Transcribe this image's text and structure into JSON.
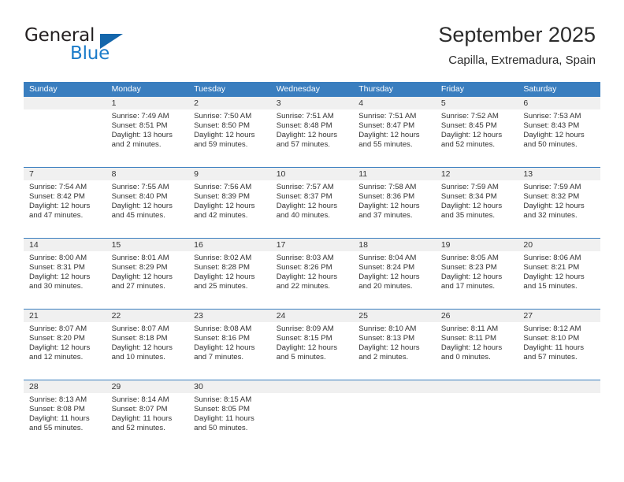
{
  "brand": {
    "name_top": "General",
    "name_bottom": "Blue",
    "triangle_color": "#1466ab",
    "blue_text_color": "#1a7bc9"
  },
  "header": {
    "title": "September 2025",
    "subtitle": "Capilla, Extremadura, Spain"
  },
  "theme": {
    "header_band": "#3a7ebf",
    "daynum_band": "#f0f0f0",
    "text": "#333333"
  },
  "weekdays": [
    "Sunday",
    "Monday",
    "Tuesday",
    "Wednesday",
    "Thursday",
    "Friday",
    "Saturday"
  ],
  "weeks": [
    [
      {
        "day": "",
        "sunrise": "",
        "sunset": "",
        "daylight_1": "",
        "daylight_2": ""
      },
      {
        "day": "1",
        "sunrise": "Sunrise: 7:49 AM",
        "sunset": "Sunset: 8:51 PM",
        "daylight_1": "Daylight: 13 hours",
        "daylight_2": "and 2 minutes."
      },
      {
        "day": "2",
        "sunrise": "Sunrise: 7:50 AM",
        "sunset": "Sunset: 8:50 PM",
        "daylight_1": "Daylight: 12 hours",
        "daylight_2": "and 59 minutes."
      },
      {
        "day": "3",
        "sunrise": "Sunrise: 7:51 AM",
        "sunset": "Sunset: 8:48 PM",
        "daylight_1": "Daylight: 12 hours",
        "daylight_2": "and 57 minutes."
      },
      {
        "day": "4",
        "sunrise": "Sunrise: 7:51 AM",
        "sunset": "Sunset: 8:47 PM",
        "daylight_1": "Daylight: 12 hours",
        "daylight_2": "and 55 minutes."
      },
      {
        "day": "5",
        "sunrise": "Sunrise: 7:52 AM",
        "sunset": "Sunset: 8:45 PM",
        "daylight_1": "Daylight: 12 hours",
        "daylight_2": "and 52 minutes."
      },
      {
        "day": "6",
        "sunrise": "Sunrise: 7:53 AM",
        "sunset": "Sunset: 8:43 PM",
        "daylight_1": "Daylight: 12 hours",
        "daylight_2": "and 50 minutes."
      }
    ],
    [
      {
        "day": "7",
        "sunrise": "Sunrise: 7:54 AM",
        "sunset": "Sunset: 8:42 PM",
        "daylight_1": "Daylight: 12 hours",
        "daylight_2": "and 47 minutes."
      },
      {
        "day": "8",
        "sunrise": "Sunrise: 7:55 AM",
        "sunset": "Sunset: 8:40 PM",
        "daylight_1": "Daylight: 12 hours",
        "daylight_2": "and 45 minutes."
      },
      {
        "day": "9",
        "sunrise": "Sunrise: 7:56 AM",
        "sunset": "Sunset: 8:39 PM",
        "daylight_1": "Daylight: 12 hours",
        "daylight_2": "and 42 minutes."
      },
      {
        "day": "10",
        "sunrise": "Sunrise: 7:57 AM",
        "sunset": "Sunset: 8:37 PM",
        "daylight_1": "Daylight: 12 hours",
        "daylight_2": "and 40 minutes."
      },
      {
        "day": "11",
        "sunrise": "Sunrise: 7:58 AM",
        "sunset": "Sunset: 8:36 PM",
        "daylight_1": "Daylight: 12 hours",
        "daylight_2": "and 37 minutes."
      },
      {
        "day": "12",
        "sunrise": "Sunrise: 7:59 AM",
        "sunset": "Sunset: 8:34 PM",
        "daylight_1": "Daylight: 12 hours",
        "daylight_2": "and 35 minutes."
      },
      {
        "day": "13",
        "sunrise": "Sunrise: 7:59 AM",
        "sunset": "Sunset: 8:32 PM",
        "daylight_1": "Daylight: 12 hours",
        "daylight_2": "and 32 minutes."
      }
    ],
    [
      {
        "day": "14",
        "sunrise": "Sunrise: 8:00 AM",
        "sunset": "Sunset: 8:31 PM",
        "daylight_1": "Daylight: 12 hours",
        "daylight_2": "and 30 minutes."
      },
      {
        "day": "15",
        "sunrise": "Sunrise: 8:01 AM",
        "sunset": "Sunset: 8:29 PM",
        "daylight_1": "Daylight: 12 hours",
        "daylight_2": "and 27 minutes."
      },
      {
        "day": "16",
        "sunrise": "Sunrise: 8:02 AM",
        "sunset": "Sunset: 8:28 PM",
        "daylight_1": "Daylight: 12 hours",
        "daylight_2": "and 25 minutes."
      },
      {
        "day": "17",
        "sunrise": "Sunrise: 8:03 AM",
        "sunset": "Sunset: 8:26 PM",
        "daylight_1": "Daylight: 12 hours",
        "daylight_2": "and 22 minutes."
      },
      {
        "day": "18",
        "sunrise": "Sunrise: 8:04 AM",
        "sunset": "Sunset: 8:24 PM",
        "daylight_1": "Daylight: 12 hours",
        "daylight_2": "and 20 minutes."
      },
      {
        "day": "19",
        "sunrise": "Sunrise: 8:05 AM",
        "sunset": "Sunset: 8:23 PM",
        "daylight_1": "Daylight: 12 hours",
        "daylight_2": "and 17 minutes."
      },
      {
        "day": "20",
        "sunrise": "Sunrise: 8:06 AM",
        "sunset": "Sunset: 8:21 PM",
        "daylight_1": "Daylight: 12 hours",
        "daylight_2": "and 15 minutes."
      }
    ],
    [
      {
        "day": "21",
        "sunrise": "Sunrise: 8:07 AM",
        "sunset": "Sunset: 8:20 PM",
        "daylight_1": "Daylight: 12 hours",
        "daylight_2": "and 12 minutes."
      },
      {
        "day": "22",
        "sunrise": "Sunrise: 8:07 AM",
        "sunset": "Sunset: 8:18 PM",
        "daylight_1": "Daylight: 12 hours",
        "daylight_2": "and 10 minutes."
      },
      {
        "day": "23",
        "sunrise": "Sunrise: 8:08 AM",
        "sunset": "Sunset: 8:16 PM",
        "daylight_1": "Daylight: 12 hours",
        "daylight_2": "and 7 minutes."
      },
      {
        "day": "24",
        "sunrise": "Sunrise: 8:09 AM",
        "sunset": "Sunset: 8:15 PM",
        "daylight_1": "Daylight: 12 hours",
        "daylight_2": "and 5 minutes."
      },
      {
        "day": "25",
        "sunrise": "Sunrise: 8:10 AM",
        "sunset": "Sunset: 8:13 PM",
        "daylight_1": "Daylight: 12 hours",
        "daylight_2": "and 2 minutes."
      },
      {
        "day": "26",
        "sunrise": "Sunrise: 8:11 AM",
        "sunset": "Sunset: 8:11 PM",
        "daylight_1": "Daylight: 12 hours",
        "daylight_2": "and 0 minutes."
      },
      {
        "day": "27",
        "sunrise": "Sunrise: 8:12 AM",
        "sunset": "Sunset: 8:10 PM",
        "daylight_1": "Daylight: 11 hours",
        "daylight_2": "and 57 minutes."
      }
    ],
    [
      {
        "day": "28",
        "sunrise": "Sunrise: 8:13 AM",
        "sunset": "Sunset: 8:08 PM",
        "daylight_1": "Daylight: 11 hours",
        "daylight_2": "and 55 minutes."
      },
      {
        "day": "29",
        "sunrise": "Sunrise: 8:14 AM",
        "sunset": "Sunset: 8:07 PM",
        "daylight_1": "Daylight: 11 hours",
        "daylight_2": "and 52 minutes."
      },
      {
        "day": "30",
        "sunrise": "Sunrise: 8:15 AM",
        "sunset": "Sunset: 8:05 PM",
        "daylight_1": "Daylight: 11 hours",
        "daylight_2": "and 50 minutes."
      },
      {
        "day": "",
        "sunrise": "",
        "sunset": "",
        "daylight_1": "",
        "daylight_2": ""
      },
      {
        "day": "",
        "sunrise": "",
        "sunset": "",
        "daylight_1": "",
        "daylight_2": ""
      },
      {
        "day": "",
        "sunrise": "",
        "sunset": "",
        "daylight_1": "",
        "daylight_2": ""
      },
      {
        "day": "",
        "sunrise": "",
        "sunset": "",
        "daylight_1": "",
        "daylight_2": ""
      }
    ]
  ]
}
